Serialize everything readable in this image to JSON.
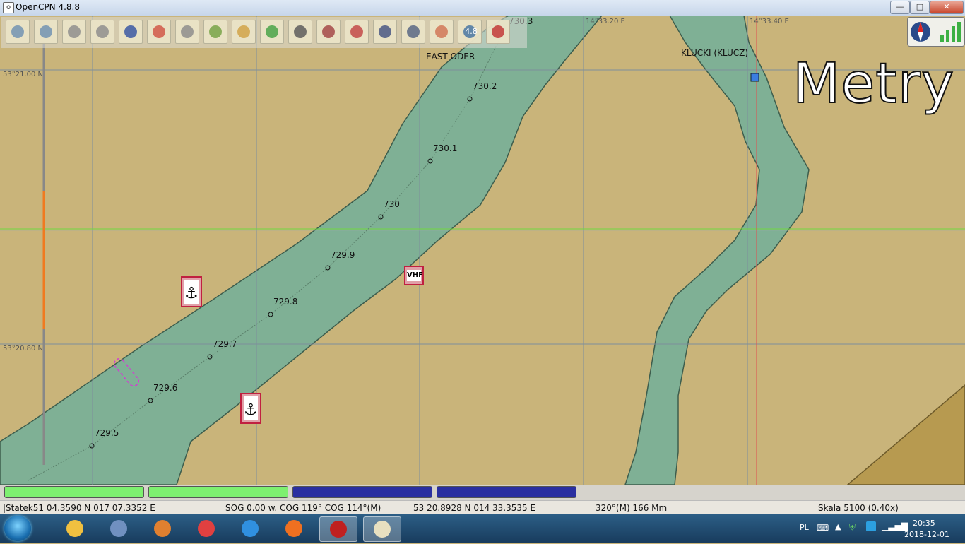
{
  "window": {
    "title": "OpenCPN 4.8.8",
    "app_icon": "opencpn-icon",
    "buttons": {
      "minimize": "—",
      "maximize": "□",
      "close": "✕"
    }
  },
  "toolbar": {
    "tools": [
      "zoom-in-icon",
      "zoom-out-icon",
      "scale-out-icon",
      "scale-in-icon",
      "route-icon",
      "ship-icon",
      "settings-wrench-icon",
      "ais-icon",
      "auto-follow-icon",
      "quilt-icon",
      "print-icon",
      "settings-chart-icon",
      "track-icon",
      "tide-icon",
      "help-icon",
      "mark-icon",
      "zoom-level-icon",
      "mob-icon"
    ],
    "zoom_badge": "4.8"
  },
  "chart": {
    "lat_labels": [
      "53°21.00 N",
      "53°20.80 N"
    ],
    "lon_labels": [
      "14°33.20 E",
      "14°33.40 E"
    ],
    "place_labels": [
      "EAST ODER",
      "KLUCKI (KLUCZ)"
    ],
    "km_labels": [
      "730.3",
      "730.2",
      "730.1",
      "730",
      "729.9",
      "729.8",
      "729.7",
      "729.6",
      "729.5"
    ],
    "vhf_label": "VHF",
    "units_overlay": "Metry",
    "colors": {
      "land": "#c9b47a",
      "water": "#7fb095",
      "grid": "#7d8e9c",
      "cursor_h": "#70d840",
      "cursor_v": "#e05050"
    }
  },
  "status_indicators": [
    {
      "color": "#7ef070"
    },
    {
      "color": "#7ef070"
    },
    {
      "color": "#2a2fa0"
    },
    {
      "color": "#2a2fa0"
    }
  ],
  "statusbar": {
    "ship_pos": "|Statek51 04.3590 N   017 07.3352 E",
    "sog_cog": "SOG 0.00 w.  COG 119°  COG 114°(M)",
    "cursor_pos": "53 20.8928 N   014 33.3535 E",
    "bearing": "320°(M)  166 Mm",
    "scale": "Skala 5100 (0.40x)"
  },
  "taskbar": {
    "apps": [
      "explorer-icon",
      "calculator-icon",
      "media-player-icon",
      "chrome-icon",
      "ie-icon",
      "firefox-icon",
      "acrobat-icon",
      "opencpn-icon"
    ],
    "lang": "PL",
    "time": "20:35",
    "date": "2018-12-01"
  }
}
